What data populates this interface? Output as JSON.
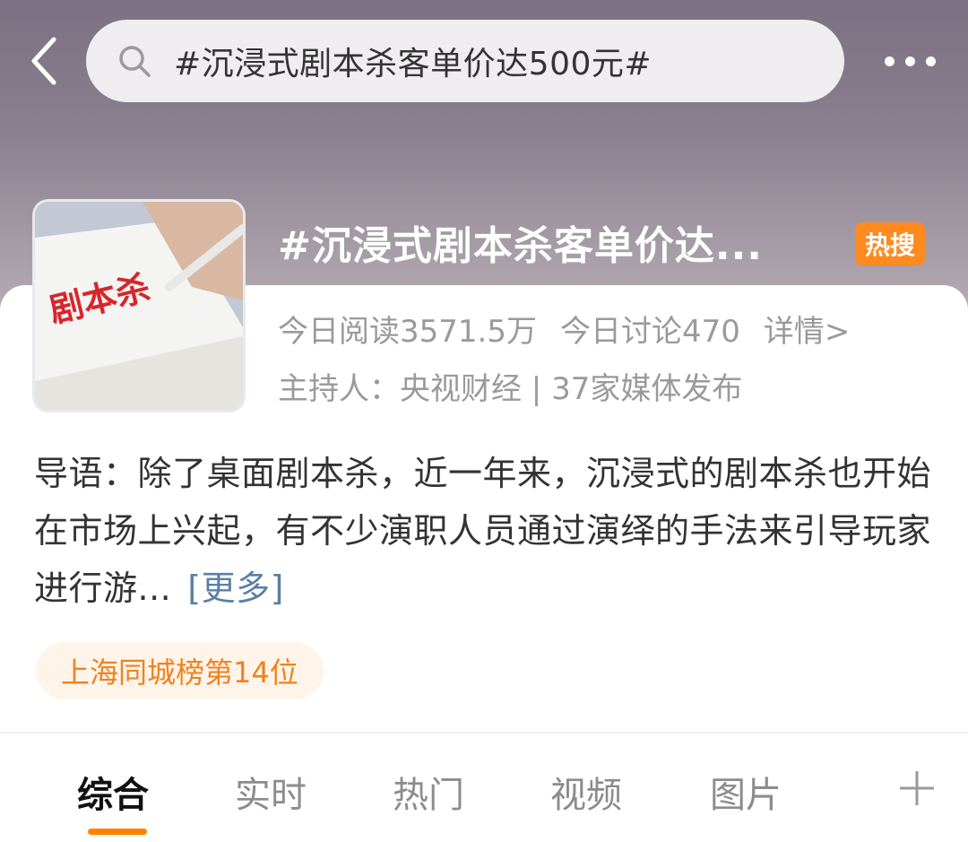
{
  "header": {
    "search_text": "#沉浸式剧本杀客单价达500元#"
  },
  "topic": {
    "title": "#沉浸式剧本杀客单价达...",
    "badge": "热搜",
    "thumbnail_text": "剧本杀",
    "stats": {
      "today_reads": "今日阅读3571.5万",
      "today_discussions": "今日讨论470",
      "details_link": "详情>"
    },
    "host_line": "主持人：央视财经 | 37家媒体发布"
  },
  "intro": {
    "text": "导语：除了桌面剧本杀，近一年来，沉浸式的剧本杀也开始在市场上兴起，有不少演职人员通过演绎的手法来引导玩家进行游...",
    "more_label": "[更多]"
  },
  "rank_chip": {
    "label": "上海同城榜第14位"
  },
  "tabs": [
    {
      "label": "综合",
      "active": true
    },
    {
      "label": "实时",
      "active": false
    },
    {
      "label": "热门",
      "active": false
    },
    {
      "label": "视频",
      "active": false
    },
    {
      "label": "图片",
      "active": false
    }
  ],
  "colors": {
    "accent": "#ff8200",
    "hot_badge": "#ff8a1f",
    "link": "#5b7fa6",
    "rank_chip_text": "#f0821e"
  },
  "icons": {
    "back": "chevron-left-icon",
    "search": "search-icon",
    "more": "more-dots-icon",
    "add_tab": "plus-icon"
  }
}
